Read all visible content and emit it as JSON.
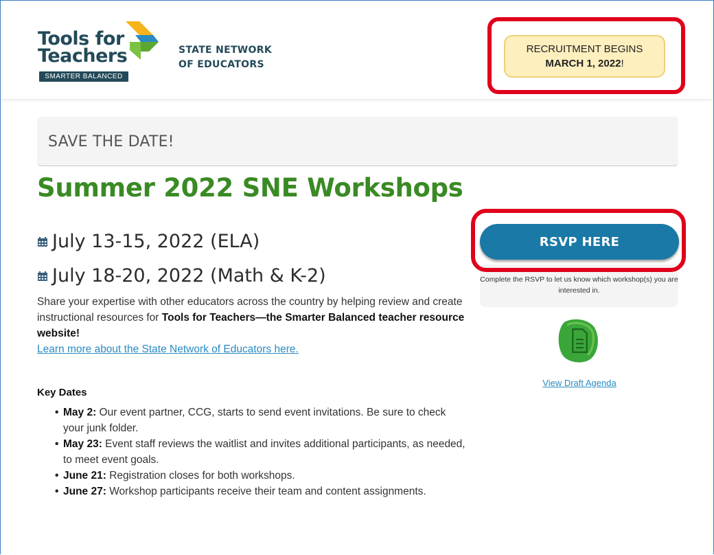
{
  "header": {
    "logo": {
      "line1": "Tools for",
      "line2": "Teachers",
      "badge": "SMARTER BALANCED"
    },
    "network": {
      "line1": "STATE NETWORK",
      "line2": "OF EDUCATORS"
    },
    "recruitment": {
      "line1": "RECRUITMENT BEGINS",
      "date": "MARCH 1, 2022",
      "suffix": "!"
    }
  },
  "banner": {
    "text": "SAVE THE DATE!"
  },
  "main": {
    "title": "Summer 2022 SNE Workshops",
    "dates": [
      {
        "icon": "calendar-icon",
        "text": "July 13-15, 2022 (ELA)"
      },
      {
        "icon": "calendar-icon",
        "text": "July 18-20, 2022 (Math & K-2)"
      }
    ],
    "description": {
      "text": "Share your expertise with other educators across the country by helping review and create instructional resources for ",
      "bold": "Tools for Teachers—the Smarter Balanced teacher resource website!",
      "link": "Learn more about the State Network of Educators here."
    },
    "key_dates": {
      "heading": "Key Dates",
      "items": [
        {
          "label": "May 2:",
          "text": " Our event partner, CCG, starts to send event invitations. Be sure to check your junk folder."
        },
        {
          "label": "May 23:",
          "text": " Event staff reviews the waitlist and invites additional participants, as needed, to meet event goals."
        },
        {
          "label": "June 21:",
          "text": " Registration closes for both workshops."
        },
        {
          "label": "June 27:",
          "text": " Workshop participants receive their team and content assignments."
        }
      ]
    }
  },
  "sidebar": {
    "rsvp_label": "RSVP HERE",
    "rsvp_note": "Complete the RSVP to let us know which workshop(s) you are interested in.",
    "agenda_icon": "document-icon",
    "agenda_link": "View Draft Agenda"
  },
  "colors": {
    "title_green": "#3a8a24",
    "button_blue": "#1a79a6",
    "highlight_red": "#e0001b",
    "recruit_yellow": "#fdefbe",
    "link_blue": "#2a8bc2",
    "brand_navy": "#234a59"
  }
}
